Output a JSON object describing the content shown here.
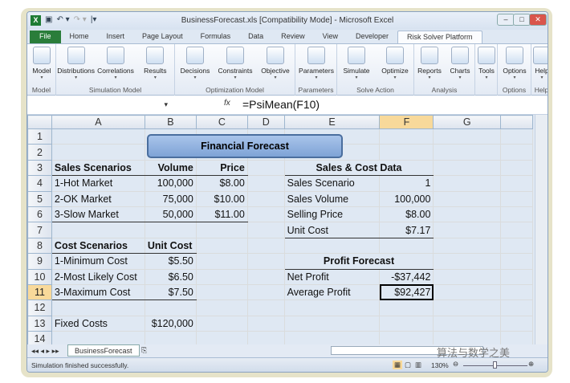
{
  "window": {
    "title": "BusinessForecast.xls  [Compatibility Mode]  -  Microsoft Excel"
  },
  "tabs": [
    "File",
    "Home",
    "Insert",
    "Page Layout",
    "Formulas",
    "Data",
    "Review",
    "View",
    "Developer",
    "Risk Solver Platform"
  ],
  "ribbon": {
    "groups": [
      {
        "label": "Model",
        "buttons": [
          "Model"
        ]
      },
      {
        "label": "Simulation Model",
        "buttons": [
          "Distributions",
          "Correlations",
          "Results"
        ]
      },
      {
        "label": "Optimization Model",
        "buttons": [
          "Decisions",
          "Constraints",
          "Objective"
        ]
      },
      {
        "label": "Parameters",
        "buttons": [
          "Parameters"
        ]
      },
      {
        "label": "Solve Action",
        "buttons": [
          "Simulate",
          "Optimize"
        ]
      },
      {
        "label": "Analysis",
        "buttons": [
          "Reports",
          "Charts"
        ]
      },
      {
        "label": "",
        "buttons": [
          "Tools"
        ]
      },
      {
        "label": "Options",
        "buttons": [
          "Options"
        ]
      },
      {
        "label": "Help",
        "buttons": [
          "Help"
        ]
      }
    ]
  },
  "formula_bar": {
    "fx": "fx",
    "formula": "=PsiMean(F10)"
  },
  "columns": [
    "A",
    "B",
    "C",
    "D",
    "E",
    "F",
    "G"
  ],
  "title_box": "Financial Forecast",
  "rows": [
    [
      "",
      "",
      "",
      "",
      "",
      "",
      ""
    ],
    [
      "",
      "",
      "",
      "",
      "",
      "",
      ""
    ],
    [
      "Sales Scenarios",
      "Volume",
      "Price",
      "",
      "Sales & Cost Data",
      "",
      ""
    ],
    [
      "1-Hot Market",
      "100,000",
      "$8.00",
      "",
      "Sales Scenario",
      "1",
      ""
    ],
    [
      "2-OK Market",
      "75,000",
      "$10.00",
      "",
      "Sales Volume",
      "100,000",
      ""
    ],
    [
      "3-Slow Market",
      "50,000",
      "$11.00",
      "",
      "Selling Price",
      "$8.00",
      ""
    ],
    [
      "",
      "",
      "",
      "",
      "Unit Cost",
      "$7.17",
      ""
    ],
    [
      "Cost Scenarios",
      "Unit Cost",
      "",
      "",
      "",
      "",
      ""
    ],
    [
      "1-Minimum Cost",
      "$5.50",
      "",
      "",
      "Profit Forecast",
      "",
      ""
    ],
    [
      "2-Most Likely Cost",
      "$6.50",
      "",
      "",
      "Net Profit",
      "-$37,442",
      ""
    ],
    [
      "3-Maximum Cost",
      "$7.50",
      "",
      "",
      "Average Profit",
      "$92,427",
      ""
    ],
    [
      "",
      "",
      "",
      "",
      "",
      "",
      ""
    ],
    [
      "Fixed Costs",
      "$120,000",
      "",
      "",
      "",
      "",
      ""
    ],
    [
      "",
      "",
      "",
      "",
      "",
      "",
      ""
    ]
  ],
  "sheet_tab": "BusinessForecast",
  "status": {
    "text": "Simulation finished successfully.",
    "zoom": "130%"
  },
  "watermark": "算法与数学之美"
}
